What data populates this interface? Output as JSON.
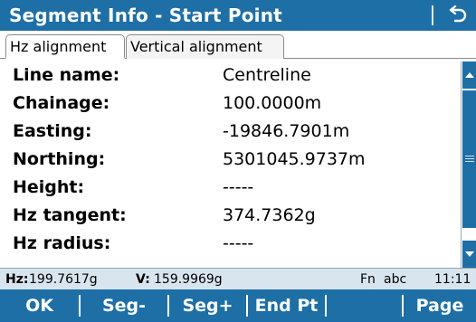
{
  "title": "Segment Info - Start Point",
  "tabs": [
    {
      "label": "Hz alignment",
      "active": true
    },
    {
      "label": "Vertical alignment",
      "active": false
    }
  ],
  "fields": [
    {
      "label": "Line name:",
      "value": "Centreline"
    },
    {
      "label": "Chainage:",
      "value": "100.0000m"
    },
    {
      "label": "Easting:",
      "value": "-19846.7901m"
    },
    {
      "label": "Northing:",
      "value": "5301045.9737m"
    },
    {
      "label": "Height:",
      "value": "-----"
    },
    {
      "label": "Hz tangent:",
      "value": "374.7362g"
    },
    {
      "label": "Hz radius:",
      "value": "-----"
    }
  ],
  "status": {
    "hz_label": "Hz:",
    "hz_value": "199.7617g",
    "v_label": "V:",
    "v_value": "159.9969g",
    "fn": "Fn",
    "input_mode": "abc",
    "time": "11:11"
  },
  "softkeys": [
    {
      "label": "OK"
    },
    {
      "label": "Seg-"
    },
    {
      "label": "Seg+"
    },
    {
      "label": "End Pt"
    },
    {
      "label": ""
    },
    {
      "label": "Page"
    }
  ],
  "colors": {
    "accent": "#1e6fa6",
    "status_bg": "#d8e4ee"
  },
  "icons": {
    "back": "back-arrow-icon",
    "scroll_up": "scroll-up-arrow-icon",
    "scroll_down": "scroll-down-arrow-icon"
  }
}
